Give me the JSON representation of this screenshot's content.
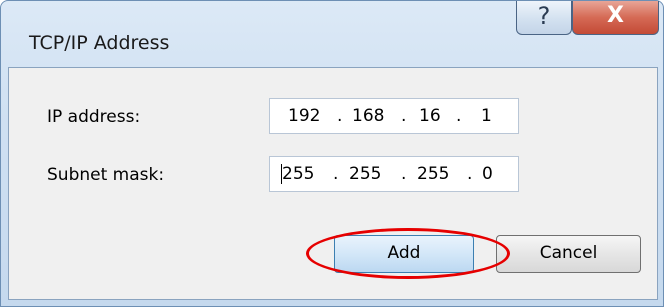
{
  "dialog": {
    "title": "TCP/IP Address",
    "help_glyph": "?",
    "close_glyph": "X"
  },
  "fields": {
    "ip_label": "IP address:",
    "ip_octets": [
      "192",
      "168",
      "16",
      "1"
    ],
    "mask_label": "Subnet mask:",
    "mask_octets": [
      "255",
      "255",
      "255",
      "0"
    ],
    "separator": "."
  },
  "buttons": {
    "add_label": "Add",
    "cancel_label": "Cancel"
  },
  "annotation": {
    "highlight_color": "#e60000",
    "highlighted": "add-button"
  }
}
